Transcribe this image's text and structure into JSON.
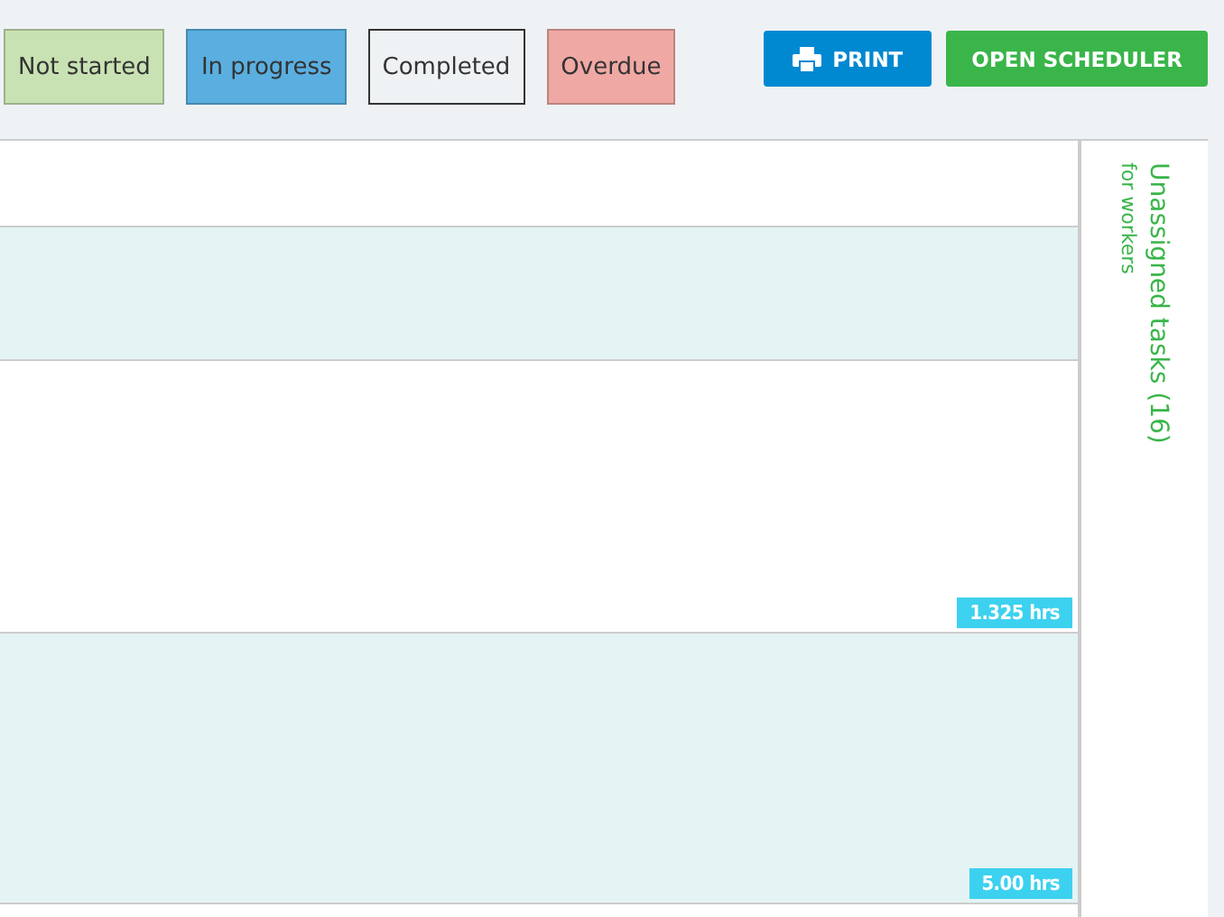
{
  "legend": [
    {
      "label": "Not started",
      "kind": "filled",
      "color": "#c9e2b3"
    },
    {
      "label": "In progress",
      "kind": "filled",
      "color": "#5aafe0"
    },
    {
      "label": "Completed",
      "kind": "outlined",
      "color": "#eef2f5"
    },
    {
      "label": "Overdue",
      "kind": "filled",
      "color": "#f0a8a4"
    }
  ],
  "buttons": [
    {
      "label": "PRINT",
      "kind": "print"
    },
    {
      "label": "OPEN SCHEDULER",
      "kind": "scheduler"
    }
  ],
  "rows": [
    {
      "shaded": false
    },
    {
      "shaded": true
    },
    {
      "shaded": false,
      "badge": "1.325 hrs"
    },
    {
      "shaded": true,
      "badge": "5.00 hrs"
    }
  ],
  "sidebar": {
    "title": "Unassigned tasks (16)",
    "subtitle": "for workers"
  }
}
